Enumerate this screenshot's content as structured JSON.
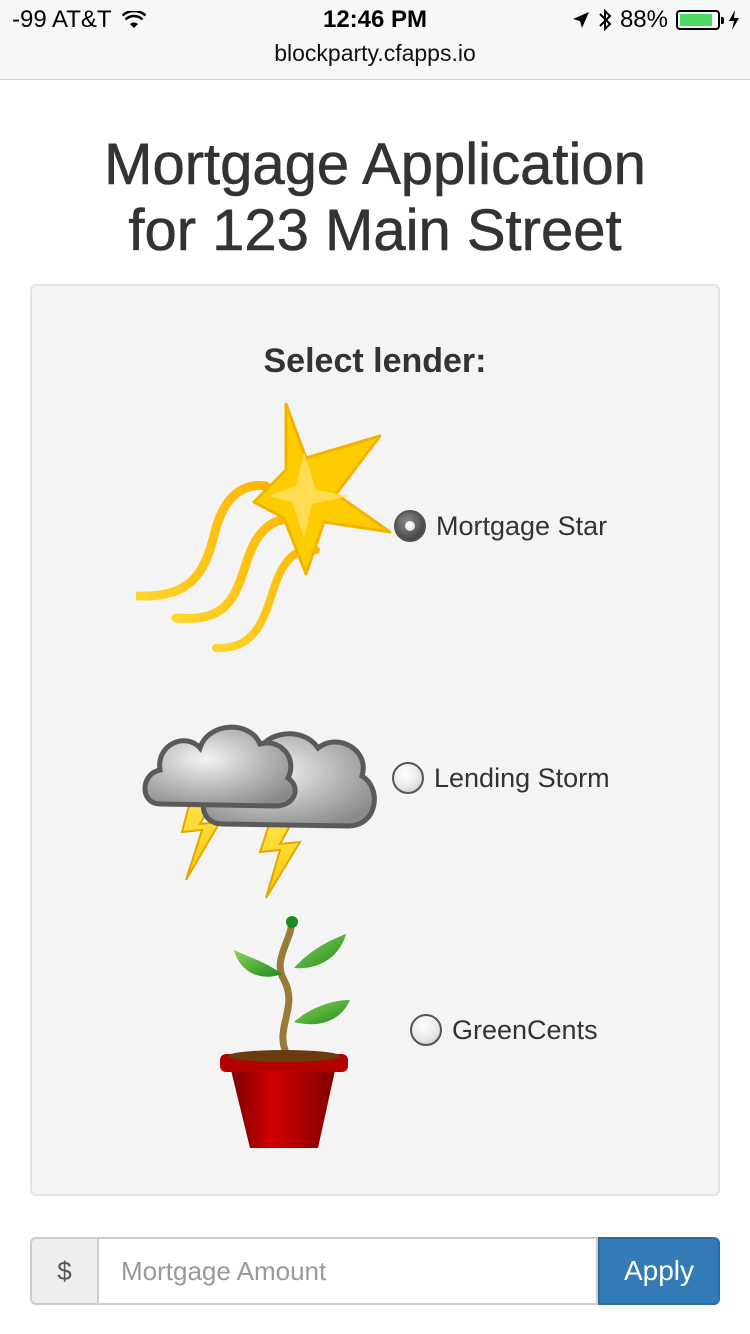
{
  "status_bar": {
    "carrier": "-99 AT&T",
    "time": "12:46 PM",
    "battery": "88%",
    "battery_level": 0.88,
    "url": "blockparty.cfapps.io"
  },
  "page": {
    "title_line1": "Mortgage Application",
    "title_line2": "for 123 Main Street"
  },
  "lender_panel": {
    "heading": "Select lender:",
    "lenders": [
      {
        "label": "Mortgage Star",
        "icon": "shooting-star-icon",
        "selected": true
      },
      {
        "label": "Lending Storm",
        "icon": "storm-cloud-icon",
        "selected": false
      },
      {
        "label": "GreenCents",
        "icon": "potted-plant-icon",
        "selected": false
      }
    ]
  },
  "amount_form": {
    "currency_symbol": "$",
    "placeholder": "Mortgage Amount",
    "value": "",
    "apply_label": "Apply"
  },
  "colors": {
    "accent": "#337ab7",
    "battery": "#4cd964",
    "star": "#ffcc00",
    "plant_pot": "#c00000"
  }
}
